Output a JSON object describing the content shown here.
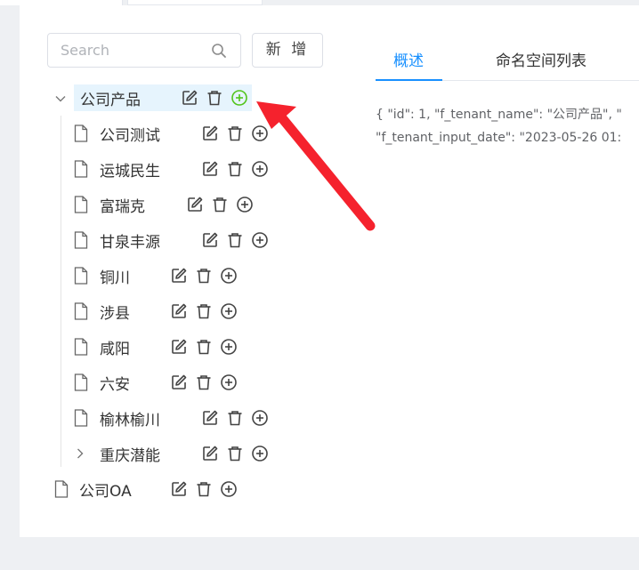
{
  "search": {
    "placeholder": "Search",
    "value": ""
  },
  "toolbar": {
    "add_label": "新 增"
  },
  "tabs": [
    {
      "label": "概述",
      "active": true
    },
    {
      "label": "命名空间列表",
      "active": false
    }
  ],
  "details": {
    "line1": "{ \"id\": 1, \"f_tenant_name\": \"公司产品\", \"",
    "line2": "\"f_tenant_input_date\": \"2023-05-26 01:"
  },
  "tree": {
    "root": {
      "label": "公司产品",
      "expanded": true,
      "selected": true
    },
    "children": [
      {
        "label": "公司测试"
      },
      {
        "label": "运城民生"
      },
      {
        "label": "富瑞克"
      },
      {
        "label": "甘泉丰源"
      },
      {
        "label": "铜川"
      },
      {
        "label": "涉县"
      },
      {
        "label": "咸阳"
      },
      {
        "label": "六安"
      },
      {
        "label": "榆林榆川"
      },
      {
        "label": "重庆潜能",
        "expandable": true
      }
    ],
    "second_root": {
      "label": "公司OA"
    }
  },
  "icons": {
    "edit": "edit-icon",
    "delete": "trash-icon",
    "add": "plus-circle-icon",
    "file": "file-icon",
    "search": "search-icon"
  },
  "colors": {
    "accent": "#1890ff",
    "add_highlight": "#52c41a",
    "selected_bg": "#e6f4fd",
    "annotation_arrow": "#f5222d"
  }
}
